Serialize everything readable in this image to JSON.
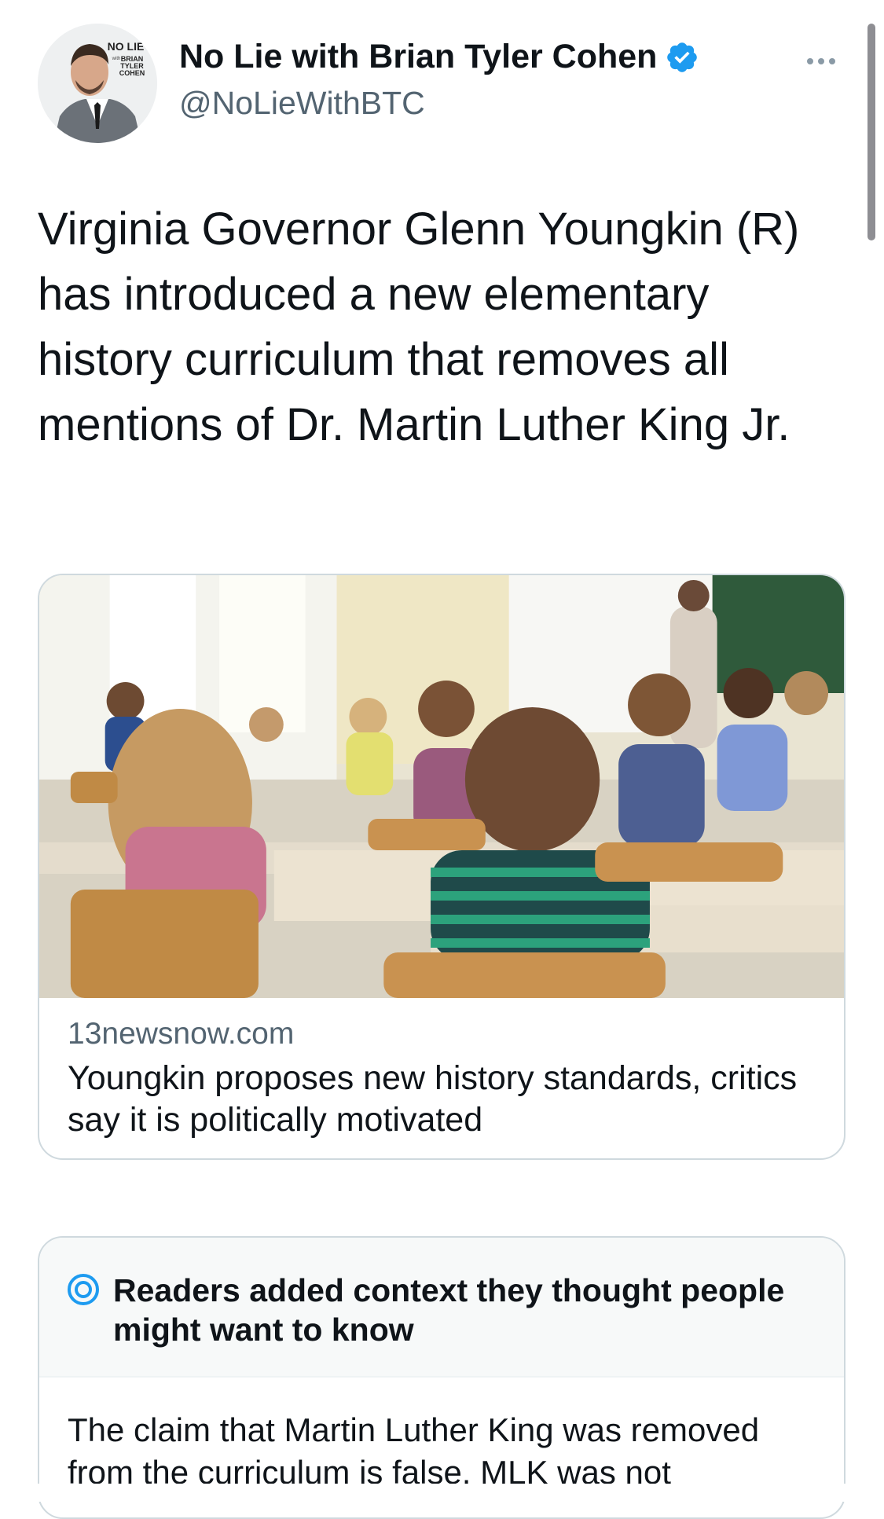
{
  "author": {
    "name": "No Lie with Brian Tyler Cohen",
    "handle": "@NoLieWithBTC",
    "verified": true,
    "avatar_logo": {
      "line1": "NO LIE",
      "line2": "with",
      "line3": "BRIAN",
      "line4": "TYLER",
      "line5": "COHEN"
    }
  },
  "tweet": {
    "text": "Virginia Governor Glenn Youngkin (R) has introduced a new elementary history curriculum that removes all mentions of Dr. Martin Luther King Jr."
  },
  "link_card": {
    "domain": "13newsnow.com",
    "title": "Youngkin proposes new history standards, critics say it is politically motivated",
    "image_description_icon": "classroom-photo"
  },
  "community_notes": {
    "heading": "Readers added context they thought people might want to know",
    "body": "The claim that Martin Luther King was removed from the curriculum is false. MLK was not"
  },
  "icons": {
    "more": "more-horizontal-icon",
    "verified": "verified-badge-icon",
    "notes": "community-notes-icon"
  },
  "colors": {
    "accent": "#1d9bf0",
    "secondary_text": "#536471",
    "border": "#cfd9de"
  }
}
